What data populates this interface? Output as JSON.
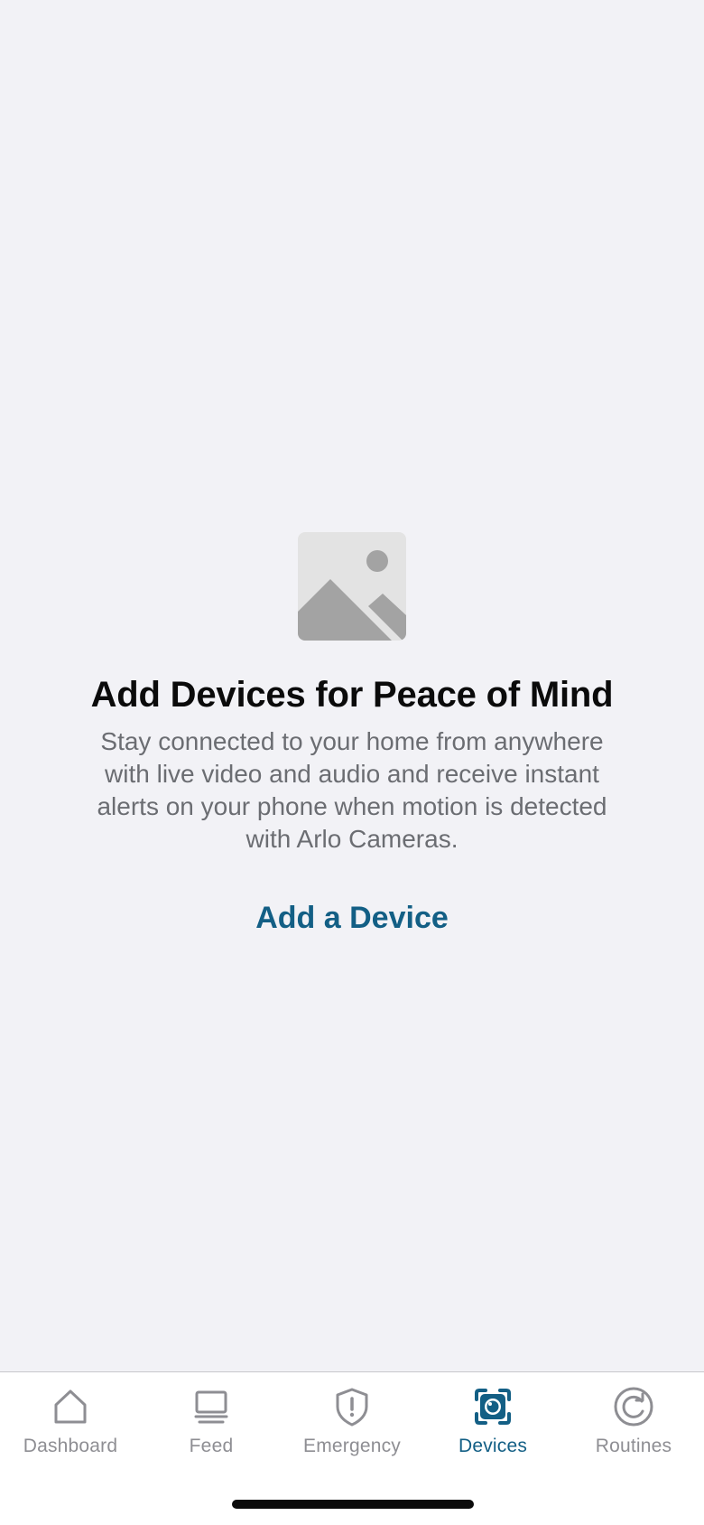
{
  "empty_state": {
    "image_icon": "image-placeholder-icon",
    "title": "Add Devices for Peace of Mind",
    "body": "Stay connected to your home from anywhere with live video and audio and receive instant alerts on your phone when motion is detected with Arlo Cameras.",
    "action_label": "Add a Device"
  },
  "tab_bar": {
    "active_tab": "Devices",
    "tabs": [
      {
        "label": "Dashboard",
        "icon": "home-icon"
      },
      {
        "label": "Feed",
        "icon": "monitor-icon"
      },
      {
        "label": "Emergency",
        "icon": "shield-alert-icon"
      },
      {
        "label": "Devices",
        "icon": "camera-icon"
      },
      {
        "label": "Routines",
        "icon": "refresh-icon"
      }
    ]
  },
  "colors": {
    "background": "#f2f2f6",
    "accent": "#135f85",
    "inactive": "#8e8e93",
    "body_text": "#6b6d72"
  }
}
